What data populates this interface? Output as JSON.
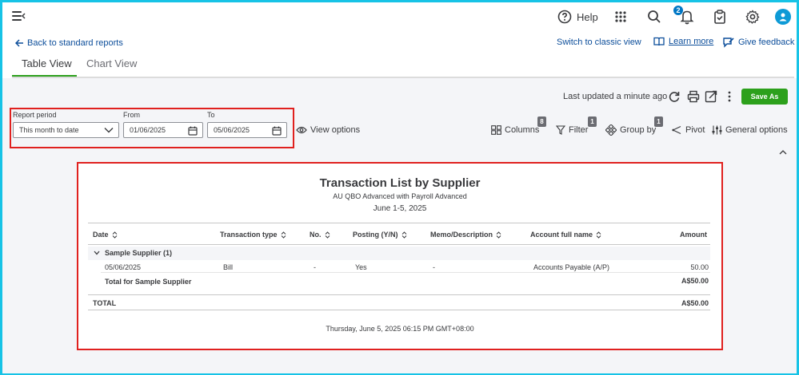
{
  "topbar": {
    "help_label": "Help",
    "notification_count": "2"
  },
  "subnav": {
    "back_label": "Back to standard reports",
    "classic_label": "Switch to classic view",
    "learn_label": "Learn more",
    "feedback_label": "Give feedback"
  },
  "tabs": [
    {
      "label": "Table View",
      "active": true
    },
    {
      "label": "Chart View",
      "active": false
    }
  ],
  "toolbar": {
    "last_updated": "Last updated a minute ago",
    "save_as_label": "Save As"
  },
  "period": {
    "report_period_label": "Report period",
    "report_period_value": "This month to date",
    "from_label": "From",
    "from_value": "01/06/2025",
    "to_label": "To",
    "to_value": "05/06/2025"
  },
  "options": {
    "view_options": "View options",
    "columns": "Columns",
    "columns_count": "8",
    "filter": "Filter",
    "filter_count": "1",
    "group_by": "Group by",
    "group_by_count": "1",
    "pivot": "Pivot",
    "general_options": "General options"
  },
  "report": {
    "title": "Transaction List by Supplier",
    "company": "AU QBO Advanced with Payroll Advanced",
    "date_range": "June 1-5, 2025",
    "columns": [
      "Date",
      "Transaction type",
      "No.",
      "Posting (Y/N)",
      "Memo/Description",
      "Account full name",
      "Amount"
    ],
    "group": {
      "label": "Sample Supplier (1)",
      "rows": [
        {
          "date": "05/06/2025",
          "type": "Bill",
          "no": "-",
          "posting": "Yes",
          "memo": "-",
          "account": "Accounts Payable (A/P)",
          "amount": "50.00"
        }
      ],
      "total_label": "Total for Sample Supplier",
      "total_amount": "A$50.00"
    },
    "grand_total_label": "TOTAL",
    "grand_total_amount": "A$50.00",
    "footer": "Thursday, June 5, 2025 06:15 PM GMT+08:00"
  },
  "colors": {
    "accent_green": "#2ca01c",
    "link_blue": "#0b4d9a",
    "highlight_red": "#e0211f",
    "frame_cyan": "#17c3e6"
  }
}
